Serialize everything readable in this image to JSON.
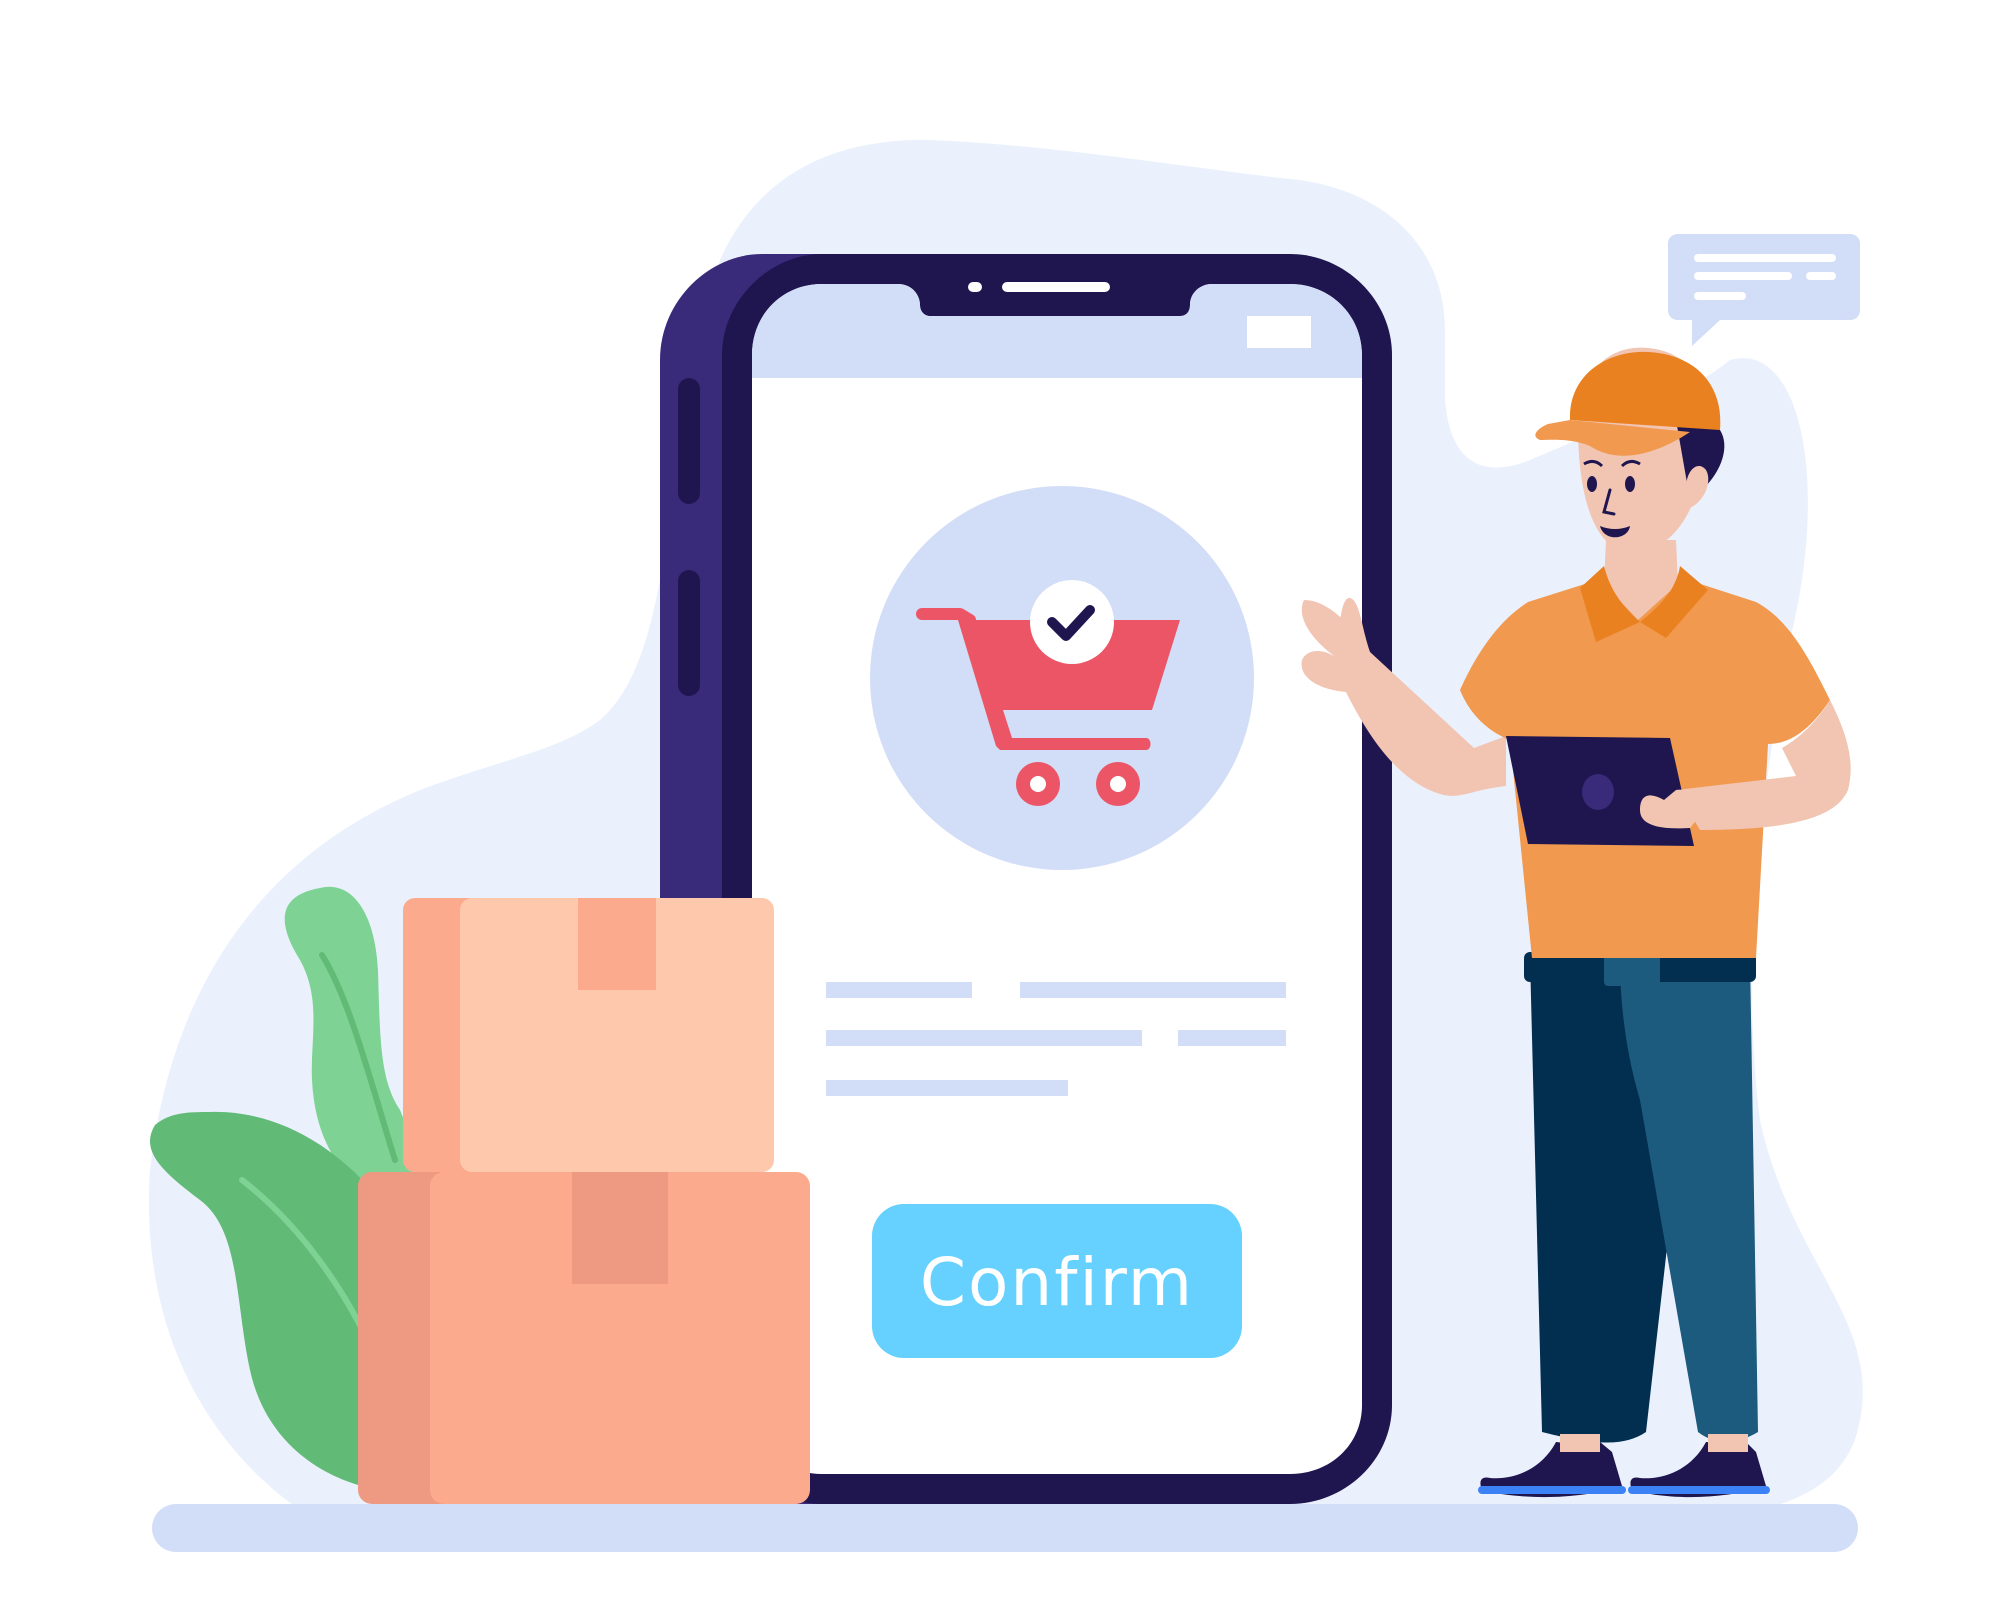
{
  "phone": {
    "confirm_label": "Confirm"
  },
  "icons": {
    "cart": "shopping-cart-icon",
    "check": "checkmark-icon",
    "chat": "chat-bubble-icon"
  },
  "colors": {
    "background_blob": "#EAF1FD",
    "soft_blue": "#D2DDF7",
    "phone_frame": "#1F1650",
    "phone_side": "#3A2A7A",
    "confirm_button": "#66D1FE",
    "cart": "#EC5566",
    "box_light": "#FEC8AD",
    "box_dark": "#FCAA8D",
    "leaf_green": "#62BA77",
    "shirt": "#F0994F",
    "cap": "#EA8121",
    "pants_dark": "#022E50",
    "pants_light": "#1C5A7E",
    "skin": "#F2C4B2"
  }
}
